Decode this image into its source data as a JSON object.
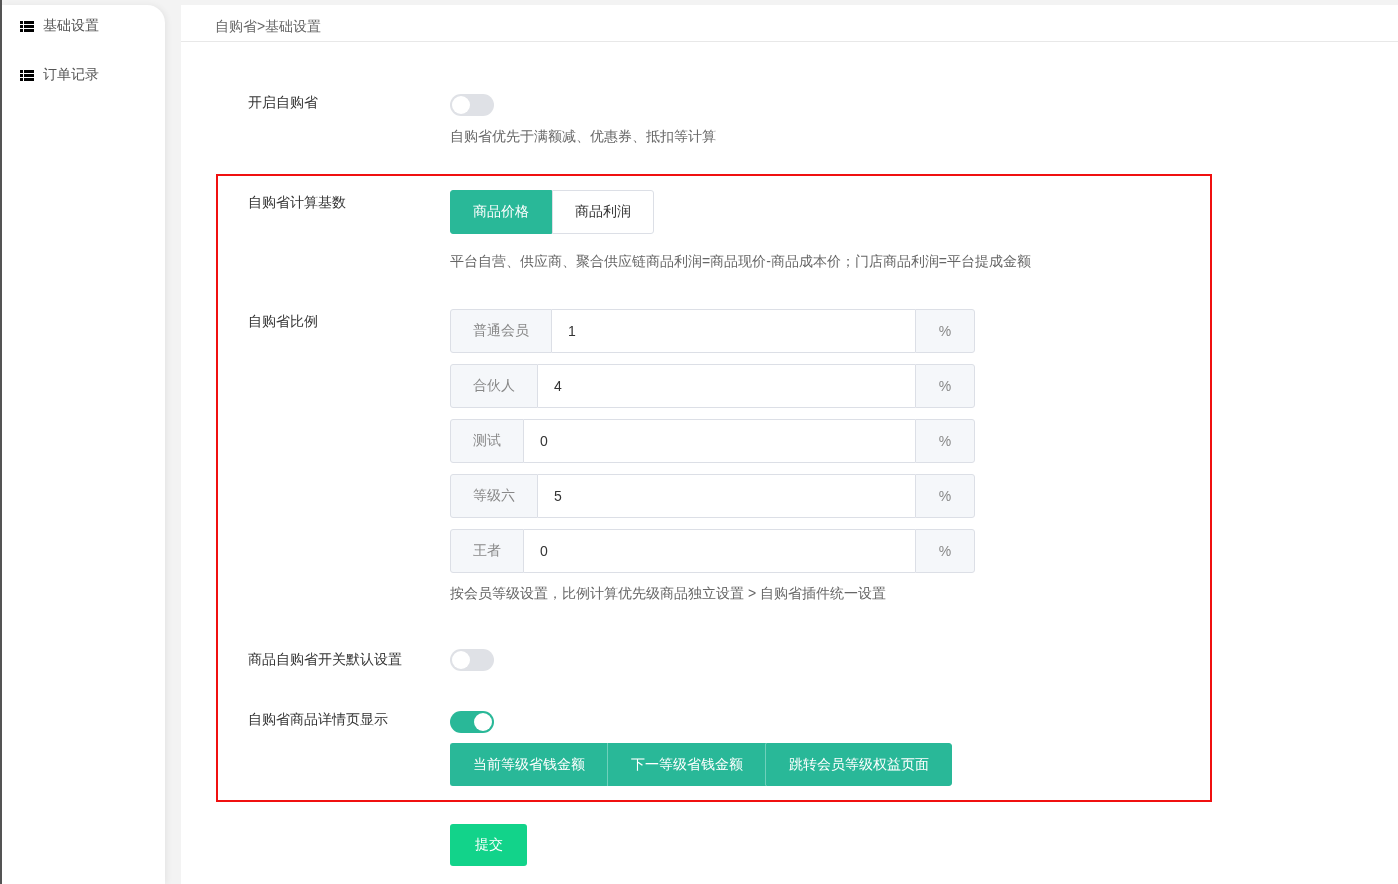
{
  "sidebar": {
    "items": [
      {
        "label": "基础设置"
      },
      {
        "label": "订单记录"
      }
    ]
  },
  "breadcrumb": "自购省>基础设置",
  "enable": {
    "label": "开启自购省",
    "on": false,
    "help": "自购省优先于满额减、优惠券、抵扣等计算"
  },
  "base": {
    "label": "自购省计算基数",
    "options": [
      {
        "label": "商品价格",
        "selected": true
      },
      {
        "label": "商品利润",
        "selected": false
      }
    ],
    "help": "平台自营、供应商、聚合供应链商品利润=商品现价-商品成本价；门店商品利润=平台提成金额"
  },
  "ratio": {
    "label": "自购省比例",
    "rows": [
      {
        "level_name": "普通会员",
        "value": "1",
        "unit": "%"
      },
      {
        "level_name": "合伙人",
        "value": "4",
        "unit": "%"
      },
      {
        "level_name": "测试",
        "value": "0",
        "unit": "%"
      },
      {
        "level_name": "等级六",
        "value": "5",
        "unit": "%"
      },
      {
        "level_name": "王者",
        "value": "0",
        "unit": "%"
      }
    ],
    "help": "按会员等级设置，比例计算优先级商品独立设置 > 自购省插件统一设置"
  },
  "default_switch": {
    "label": "商品自购省开关默认设置",
    "on": false
  },
  "detail_display": {
    "label": "自购省商品详情页显示",
    "on": true,
    "options": [
      {
        "label": "当前等级省钱金额",
        "selected": true
      },
      {
        "label": "下一等级省钱金额",
        "selected": true
      },
      {
        "label": "跳转会员等级权益页面",
        "selected": true
      }
    ]
  },
  "submit": "提交"
}
